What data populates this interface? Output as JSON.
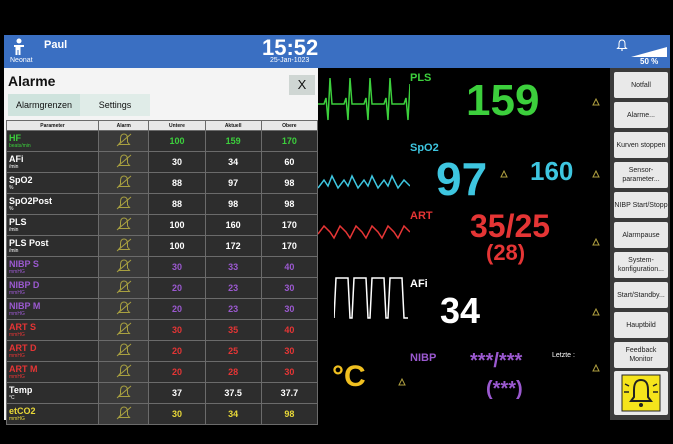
{
  "topbar": {
    "patient_name": "Paul",
    "patient_type": "Neonat",
    "time": "15:52",
    "date": "25-Jan-1023",
    "volume": "50 %"
  },
  "dialog": {
    "title": "Alarme",
    "close_label": "X",
    "tabs": [
      "Alarmgrenzen",
      "Settings"
    ],
    "columns": [
      "Parameter",
      "Alarm",
      "Untere",
      "Aktuell",
      "Obere"
    ],
    "rows": [
      {
        "name": "HF",
        "unit": "beats/min",
        "lower": "100",
        "current": "159",
        "upper": "170",
        "color": "#3ccf3c"
      },
      {
        "name": "AFi",
        "unit": "/min",
        "lower": "30",
        "current": "34",
        "upper": "60",
        "color": "#ffffff"
      },
      {
        "name": "SpO2",
        "unit": "%",
        "lower": "88",
        "current": "97",
        "upper": "98",
        "color": "#ffffff"
      },
      {
        "name": "SpO2Post",
        "unit": "%",
        "lower": "88",
        "current": "98",
        "upper": "98",
        "color": "#ffffff"
      },
      {
        "name": "PLS",
        "unit": "/min",
        "lower": "100",
        "current": "160",
        "upper": "170",
        "color": "#ffffff"
      },
      {
        "name": "PLS Post",
        "unit": "/min",
        "lower": "100",
        "current": "172",
        "upper": "170",
        "color": "#ffffff"
      },
      {
        "name": "NIBP S",
        "unit": "mmHG",
        "lower": "30",
        "current": "33",
        "upper": "40",
        "color": "#9b59d0"
      },
      {
        "name": "NIBP D",
        "unit": "mmHG",
        "lower": "20",
        "current": "23",
        "upper": "30",
        "color": "#9b59d0"
      },
      {
        "name": "NIBP M",
        "unit": "mmHG",
        "lower": "20",
        "current": "23",
        "upper": "30",
        "color": "#9b59d0"
      },
      {
        "name": "ART S",
        "unit": "mmHG",
        "lower": "30",
        "current": "35",
        "upper": "40",
        "color": "#e53535"
      },
      {
        "name": "ART D",
        "unit": "mmHG",
        "lower": "20",
        "current": "25",
        "upper": "30",
        "color": "#e53535"
      },
      {
        "name": "ART M",
        "unit": "mmHG",
        "lower": "20",
        "current": "28",
        "upper": "30",
        "color": "#e53535"
      },
      {
        "name": "Temp",
        "unit": "°C",
        "lower": "37",
        "current": "37.5",
        "upper": "37.7",
        "color": "#ffffff"
      },
      {
        "name": "etCO2",
        "unit": "mmHG",
        "lower": "30",
        "current": "34",
        "upper": "98",
        "color": "#e8d838"
      }
    ]
  },
  "monitor": {
    "pls_label": "PLS",
    "pls_value": "159",
    "spo2_label": "SpO2",
    "spo2_value": "97",
    "spo2_pulse": "160",
    "art_label": "ART",
    "art_value": "35/25",
    "art_mean": "(28)",
    "afi_label": "AFi",
    "afi_value": "34",
    "nibp_label": "NIBP",
    "nibp_value": "***/***",
    "nibp_mean": "(***)",
    "nibp_last": "Letzte :",
    "temp_value": "°C",
    "colors": {
      "pls": "#3ccf3c",
      "spo2": "#3ec6e0",
      "art": "#e53535",
      "afi": "#ffffff",
      "nibp": "#9b59d0",
      "temp": "#f0c020"
    }
  },
  "rightpanel": {
    "buttons": [
      "Notfall",
      "Alarme...",
      "Kurven stoppen",
      "Sensor-parameter...",
      "NIBP Start/Stopp",
      "Alarmpause",
      "System-konfiguration...",
      "Start/Standby...",
      "Hauptbild",
      "Feedback Monitor"
    ],
    "alarm_icon": "alarm-bell-icon"
  }
}
